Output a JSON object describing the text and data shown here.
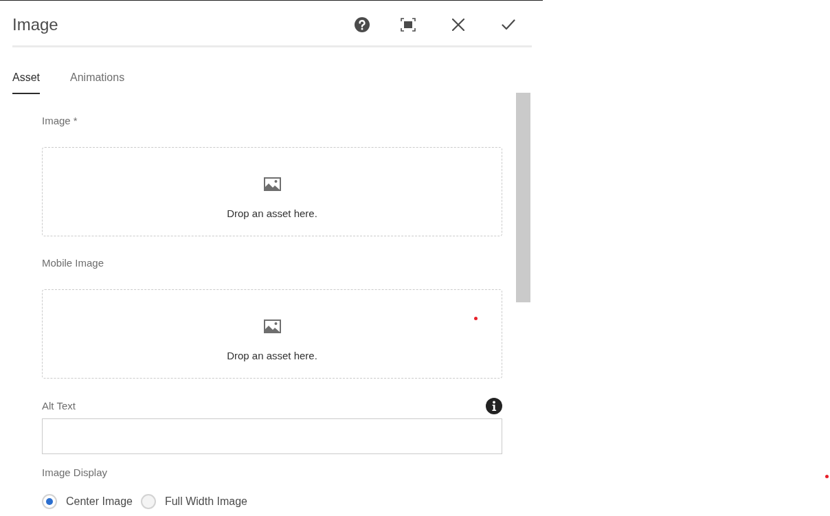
{
  "window": {
    "title": "Image"
  },
  "tabs": [
    {
      "label": "Asset",
      "selected": true
    },
    {
      "label": "Animations",
      "selected": false
    }
  ],
  "fields": [
    {
      "kind": "dropzone",
      "label": "Image *",
      "hint": "Drop an asset here."
    },
    {
      "kind": "dropzone",
      "label": "Mobile Image",
      "hint": "Drop an asset here."
    },
    {
      "kind": "text",
      "label": "Alt Text"
    },
    {
      "kind": "radio",
      "label": "Image Display",
      "options": [
        {
          "label": "Center Image",
          "selected": true
        },
        {
          "label": "Full Width Image",
          "selected": false
        }
      ]
    }
  ]
}
